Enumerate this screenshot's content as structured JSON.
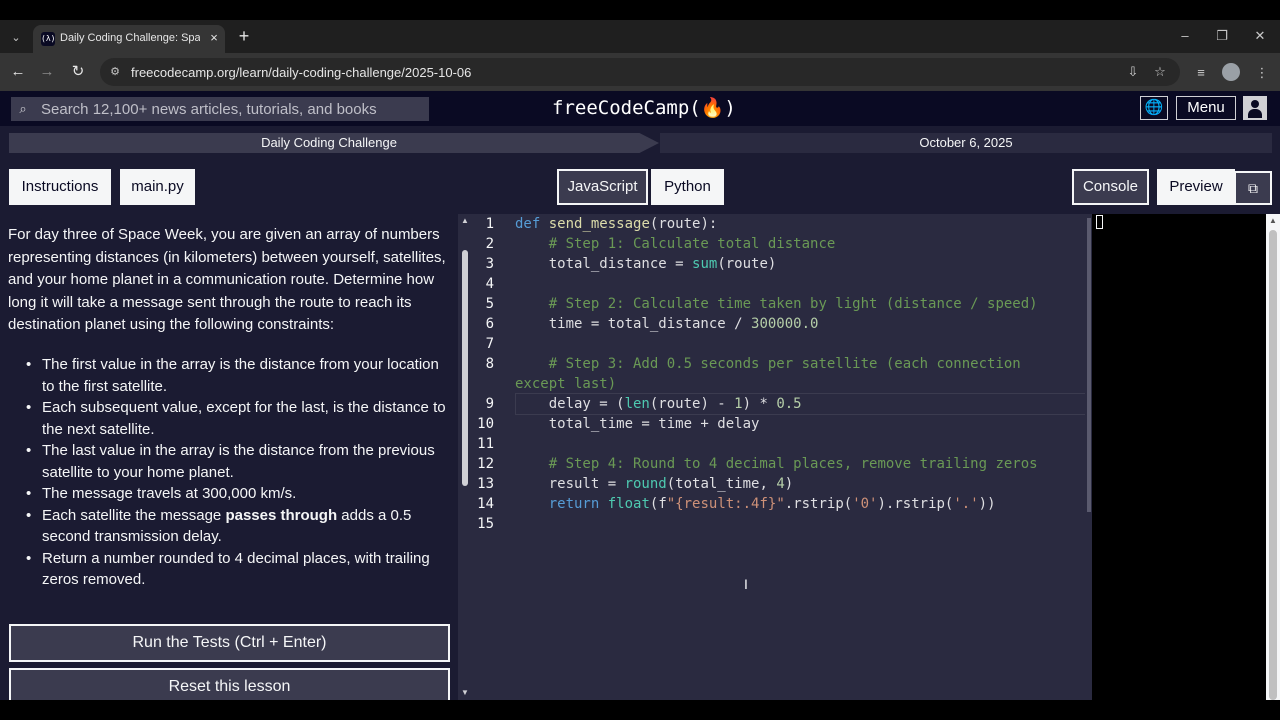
{
  "browser": {
    "tab_title": "Daily Coding Challenge: Space W",
    "url": "freecodecamp.org/learn/daily-coding-challenge/2025-10-06",
    "favicon_text": "(λ)"
  },
  "fcc": {
    "search_placeholder": "Search 12,100+ news articles, tutorials, and books",
    "logo_text": "freeCodeCamp(🔥)",
    "menu_label": "Menu"
  },
  "challenge_bar": {
    "title": "Daily Coding Challenge",
    "date": "October 6, 2025"
  },
  "tabs": {
    "instructions": "Instructions",
    "file": "main.py",
    "javascript": "JavaScript",
    "python": "Python",
    "console": "Console",
    "preview": "Preview"
  },
  "instructions": {
    "intro": "For day three of Space Week, you are given an array of numbers representing distances (in kilometers) between yourself, satellites, and your home planet in a communication route. Determine how long it will take a message sent through the route to reach its destination planet using the following constraints:",
    "bullets": [
      "The first value in the array is the distance from your location to the first satellite.",
      "Each subsequent value, except for the last, is the distance to the next satellite.",
      "The last value in the array is the distance from the previous satellite to your home planet.",
      "The message travels at 300,000 km/s."
    ],
    "bullet5_pre": "Each satellite the message ",
    "bullet5_bold": "passes through",
    "bullet5_post": " adds a 0.5 second transmission delay.",
    "bullet6": "Return a number rounded to 4 decimal places, with trailing zeros removed.",
    "run_button": "Run the Tests (Ctrl + Enter)",
    "reset_button": "Reset this lesson"
  },
  "editor": {
    "line_numbers": [
      "1",
      "2",
      "3",
      "4",
      "5",
      "6",
      "7",
      "8",
      "9",
      "10",
      "11",
      "12",
      "13",
      "14",
      "15"
    ],
    "l1_kw": "def",
    "l1_fn": "send_message",
    "l1_rest": "(route):",
    "l2": "# Step 1: Calculate total distance",
    "l3_a": "total_distance = ",
    "l3_bi": "sum",
    "l3_b": "(route)",
    "l5": "# Step 2: Calculate time taken by light (distance / speed)",
    "l6_a": "time = total_distance / ",
    "l6_num": "300000.0",
    "l8a": "# Step 3: Add 0.5 seconds per satellite (each connection",
    "l8b": "except last)",
    "l9_a": "delay = (",
    "l9_bi": "len",
    "l9_b": "(route) - ",
    "l9_n1": "1",
    "l9_c": ") * ",
    "l9_n2": "0.5",
    "l10": "total_time = time + delay",
    "l12": "# Step 4: Round to 4 decimal places, remove trailing zeros",
    "l13_a": "result = ",
    "l13_bi": "round",
    "l13_b": "(total_time, ",
    "l13_n": "4",
    "l13_c": ")",
    "l14_kw": "return",
    "l14_bi": "float",
    "l14_a": "(f",
    "l14_str": "\"{result:.4f}\"",
    "l14_b": ".rstrip(",
    "l14_s2": "'0'",
    "l14_c": ").rstrip(",
    "l14_s3": "'.'",
    "l14_d": "))"
  }
}
